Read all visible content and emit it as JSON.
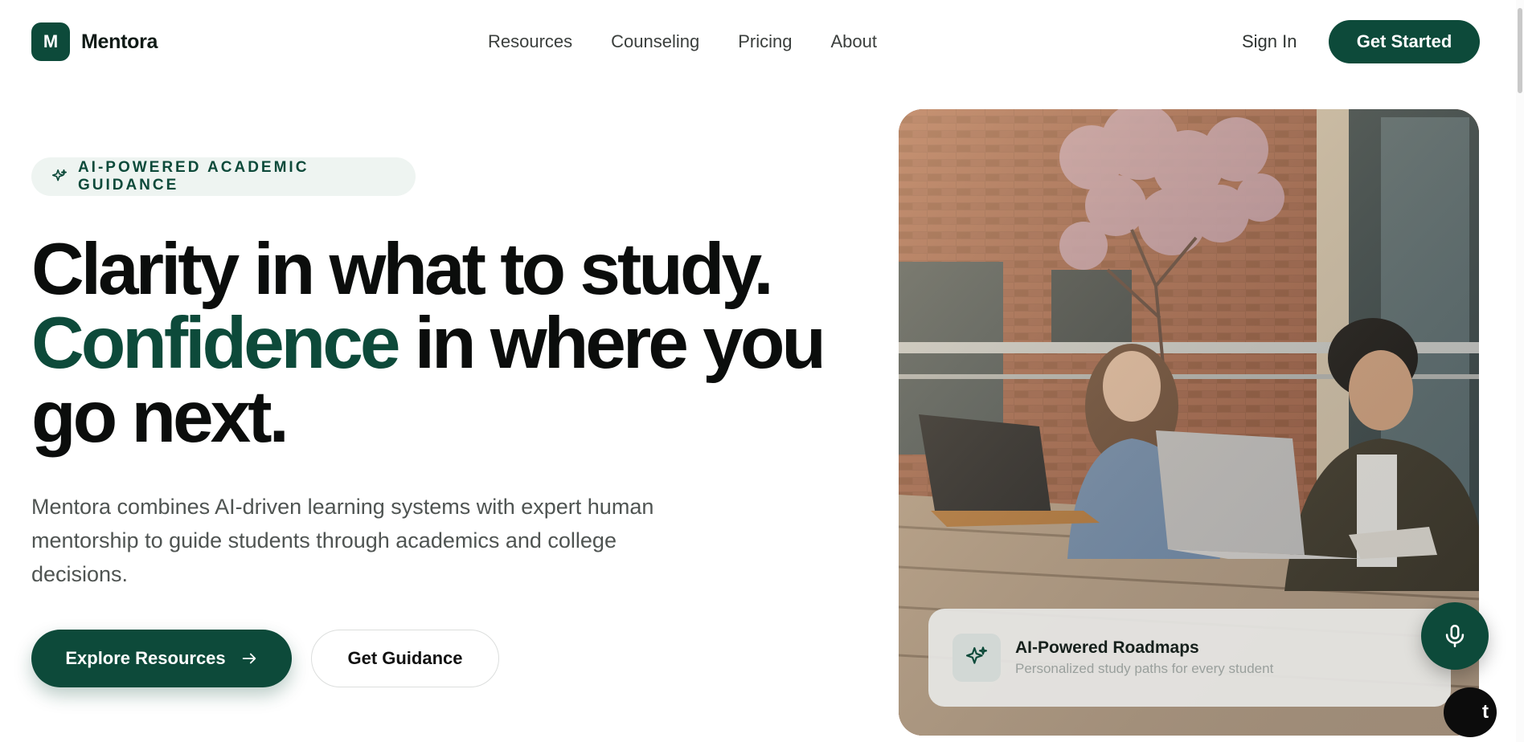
{
  "brand": {
    "mark": "M",
    "name": "Mentora"
  },
  "nav": {
    "items": [
      {
        "label": "Resources"
      },
      {
        "label": "Counseling"
      },
      {
        "label": "Pricing"
      },
      {
        "label": "About"
      }
    ],
    "sign_in": "Sign In",
    "get_started": "Get Started"
  },
  "hero": {
    "badge": "AI-POWERED ACADEMIC GUIDANCE",
    "headline_line1": "Clarity in what to study.",
    "headline_accent": "Confidence",
    "headline_line2_rest": " in where you go next.",
    "lede": "Mentora combines AI-driven learning systems with expert human mentorship to guide students through academics and college decisions.",
    "primary_cta": "Explore Resources",
    "secondary_cta": "Get Guidance"
  },
  "feature_card": {
    "title": "AI-Powered Roadmaps",
    "subtitle": "Personalized study paths for every student"
  },
  "chat": {
    "glyph": "t"
  },
  "colors": {
    "brand_green": "#0d4a3a",
    "badge_bg": "#eef4f1",
    "text_dark": "#0b0d0c",
    "text_muted": "#4f5452"
  },
  "icons": {
    "badge": "sparkle-icon",
    "primary_cta": "arrow-right-icon",
    "feature": "sparkle-icon",
    "mic": "microphone-icon"
  }
}
